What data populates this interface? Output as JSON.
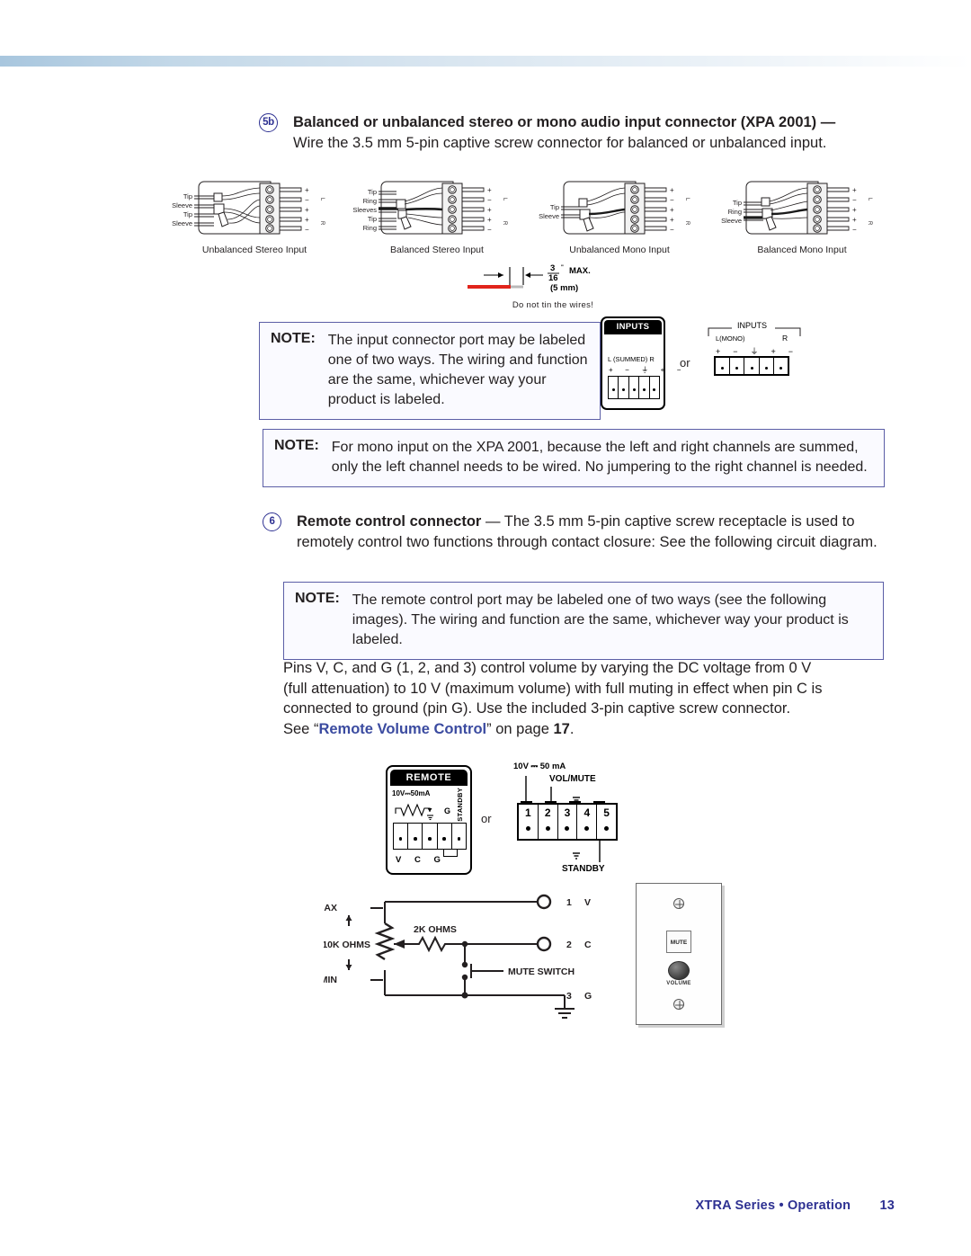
{
  "document": {
    "footer_title": "XTRA Series • Operation",
    "page_number": "13"
  },
  "section_5b": {
    "number": "5b",
    "title": "Balanced or unbalanced stereo or mono audio input connector (XPA 2001) —",
    "body": "Wire the 3.5 mm 5-pin captive screw connector for balanced or unbalanced input."
  },
  "connector_figures": [
    {
      "caption": "Unbalanced Stereo Input",
      "wire_labels": [
        "Tip",
        "Sleeve",
        "Tip",
        "Sleeve"
      ]
    },
    {
      "caption": "Balanced Stereo Input",
      "wire_labels": [
        "Tip",
        "Ring",
        "Sleeves",
        "Tip",
        "Ring"
      ]
    },
    {
      "caption": "Unbalanced Mono Input",
      "wire_labels": [
        "Tip",
        "Sleeve"
      ]
    },
    {
      "caption": "Balanced Mono Input",
      "wire_labels": [
        "Tip",
        "Ring",
        "Sleeve"
      ]
    }
  ],
  "connector_pin_symbols": [
    "+",
    "−",
    "⏚",
    "+",
    "−"
  ],
  "connector_channel_labels": [
    "L",
    "R"
  ],
  "strip_detail": {
    "fraction_numerator": "3",
    "fraction_denominator": "16",
    "unit": "\"",
    "max_label": "MAX.",
    "metric": "(5 mm)",
    "warning": "Do not tin the wires!"
  },
  "note_1": {
    "label": "NOTE:",
    "text": "The input connector port may be labeled one of two ways. The wiring and function are the same, whichever way your product is labeled."
  },
  "note_2": {
    "label": "NOTE:",
    "text": "For mono input on the XPA 2001, because the left and right channels are summed, only the left channel needs to be wired. No jumpering to the right channel is needed."
  },
  "note_3": {
    "label": "NOTE:",
    "text": "The remote control port may be labeled one of two ways (see the following images). The wiring and function are the same, whichever way your product is labeled."
  },
  "inputs_panels": {
    "or_text": "or",
    "variant_a": {
      "header": "INPUTS",
      "channel_line": "L (SUMMED) R",
      "symbols": [
        "+",
        "−",
        "⏚",
        "+",
        "−"
      ]
    },
    "variant_b": {
      "header": "INPUTS",
      "left_label": "L(MONO)",
      "right_label": "R",
      "symbols": [
        "+",
        "−",
        "⏚",
        "+",
        "−"
      ]
    }
  },
  "section_6": {
    "number": "6",
    "title": "Remote control connector",
    "body": "— The 3.5 mm 5-pin captive screw receptacle is used to remotely control two functions through contact closure:  See the following circuit diagram."
  },
  "paragraph": {
    "line1": "Pins V, C, and G (1, 2, and 3) control volume by varying the DC voltage from 0 V",
    "line2": "(full attenuation) to 10 V (maximum volume) with full muting in effect when pin C is",
    "line3": "connected to ground (pin G). Use the included 3-pin captive screw connector.",
    "see_prefix": "See “",
    "link_text": "Remote Volume Control",
    "see_middle": "” on page ",
    "page_ref": "17",
    "see_suffix": "."
  },
  "remote_panels": {
    "or_text": "or",
    "variant_a": {
      "header": "REMOTE",
      "rating": "10V⎓50mA",
      "ground_label": "G",
      "standby_label": "STANDBY",
      "pin_labels": [
        "V",
        "C",
        "G"
      ]
    },
    "variant_b": {
      "rating": "10V ⎓ 50 mA",
      "vol_mute_label": "VOL/MUTE",
      "standby_label": "STANDBY",
      "pin_numbers": [
        "1",
        "2",
        "3",
        "4",
        "5"
      ]
    }
  },
  "circuit": {
    "max_label": "MAX",
    "min_label": "MIN",
    "pot_value": "10K OHMS",
    "resistor_value": "2K OHMS",
    "mute_switch_label": "MUTE SWITCH",
    "terminals": [
      {
        "number": "1",
        "name": "V"
      },
      {
        "number": "2",
        "name": "C"
      },
      {
        "number": "3",
        "name": "G"
      }
    ]
  },
  "wall_plate": {
    "mute_label": "MUTE",
    "volume_label": "VOLUME"
  },
  "colors": {
    "accent": "#2e3192",
    "note_border": "#5b5ea6",
    "link": "#3b4ba0"
  }
}
